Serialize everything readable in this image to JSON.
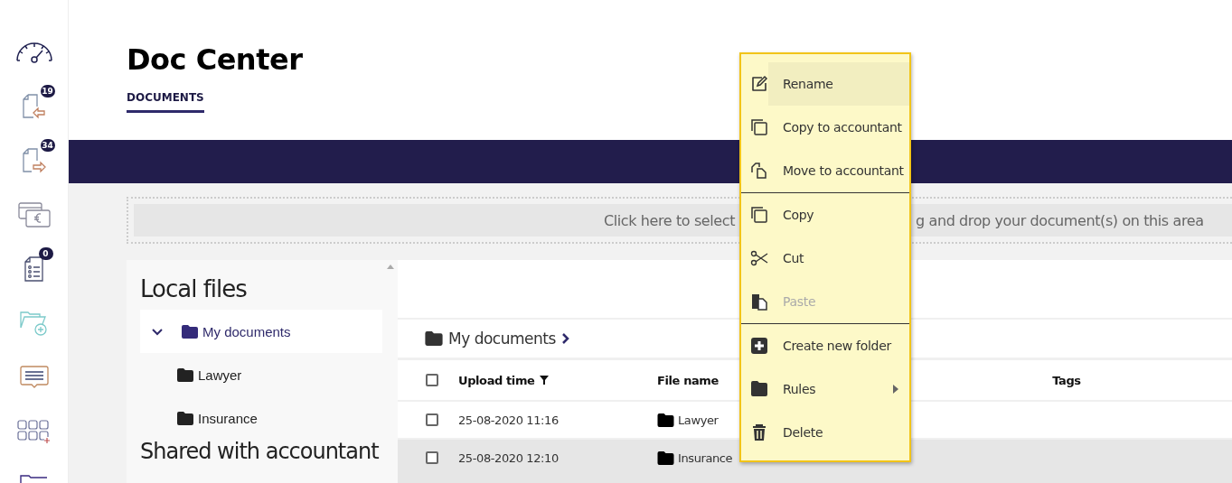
{
  "rail": {
    "items": [
      {
        "kind": "gauge"
      },
      {
        "kind": "file-in",
        "badge": "19"
      },
      {
        "kind": "file-out",
        "badge": "34"
      },
      {
        "kind": "money"
      },
      {
        "kind": "checklist",
        "badge": "0"
      },
      {
        "kind": "folder-add"
      },
      {
        "kind": "message"
      },
      {
        "kind": "grid-add"
      },
      {
        "kind": "folder"
      }
    ]
  },
  "header": {
    "title": "Doc Center",
    "tabs": [
      {
        "label": "DOCUMENTS",
        "selected": true
      }
    ]
  },
  "dropzone": {
    "text_before": "Click here to select",
    "text_after": "g and drop your document(s) on this area"
  },
  "tree": {
    "sections": [
      {
        "title": "Local files",
        "items": [
          {
            "label": "My documents",
            "expanded": true,
            "selected": true,
            "children": [
              {
                "label": "Lawyer",
                "selected": false
              },
              {
                "label": "Insurance",
                "selected": false
              }
            ]
          }
        ]
      },
      {
        "title": "Shared with accountant"
      }
    ]
  },
  "breadcrumb": [
    {
      "label": "My documents"
    }
  ],
  "table": {
    "header_checked": false,
    "columns": [
      {
        "label": "Upload time",
        "filter": true
      },
      {
        "label": "File name",
        "filter": false
      },
      {
        "label": "Tags",
        "filter": false
      }
    ],
    "rows": [
      {
        "kind": "folder",
        "checked": false,
        "selected": false,
        "cells": [
          "25-08-2020 11:16",
          "Lawyer"
        ]
      },
      {
        "kind": "folder",
        "checked": false,
        "selected": true,
        "cells": [
          "25-08-2020 12:10",
          "Insurance"
        ]
      }
    ]
  },
  "context_menu": {
    "groups": [
      [
        {
          "kind": "rename",
          "label": "Rename",
          "highlighted": true,
          "disabled": false,
          "submenu": false
        },
        {
          "kind": "copy-to",
          "label": "Copy to accountant",
          "highlighted": false,
          "disabled": false,
          "submenu": false
        },
        {
          "kind": "move-to",
          "label": "Move to accountant",
          "highlighted": false,
          "disabled": false,
          "submenu": false
        }
      ],
      [
        {
          "kind": "copy",
          "label": "Copy",
          "highlighted": false,
          "disabled": false,
          "submenu": false
        },
        {
          "kind": "cut",
          "label": "Cut",
          "highlighted": false,
          "disabled": false,
          "submenu": false
        },
        {
          "kind": "paste",
          "label": "Paste",
          "highlighted": false,
          "disabled": true,
          "submenu": false
        }
      ],
      [
        {
          "kind": "new-folder",
          "label": "Create new folder",
          "highlighted": false,
          "disabled": false,
          "submenu": false
        },
        {
          "kind": "rules",
          "label": "Rules",
          "highlighted": false,
          "disabled": false,
          "submenu": true
        },
        {
          "kind": "delete",
          "label": "Delete",
          "highlighted": false,
          "disabled": false,
          "submenu": false
        }
      ]
    ]
  }
}
